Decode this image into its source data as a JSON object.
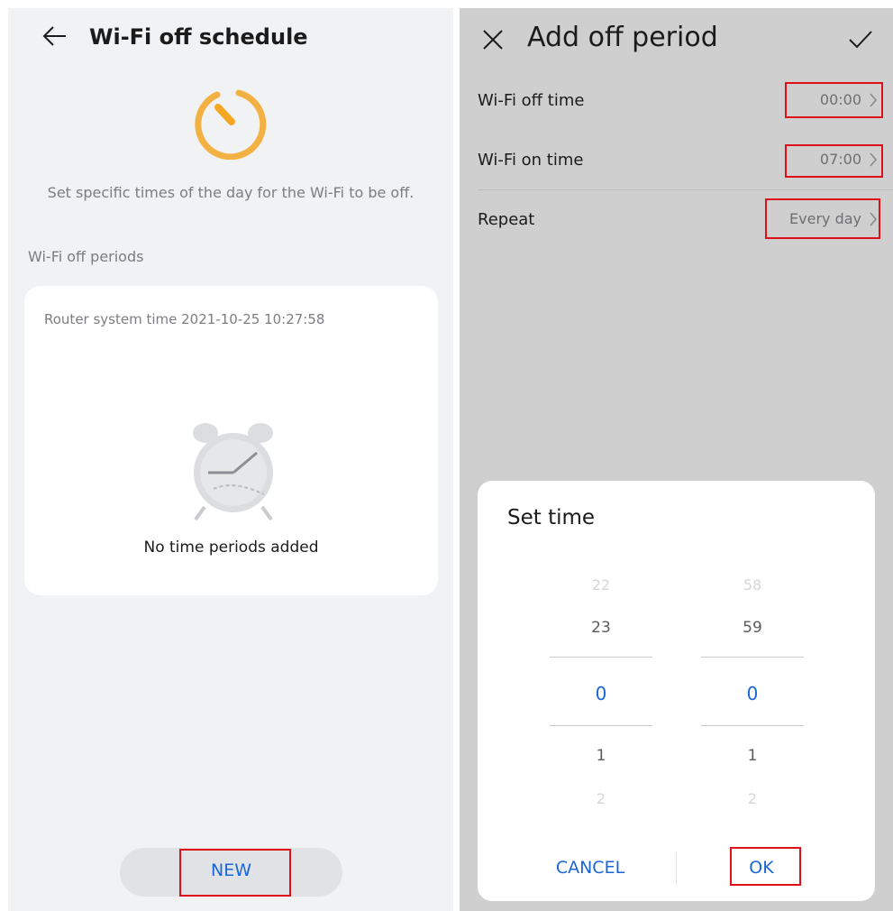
{
  "left": {
    "header": {
      "title": "Wi-Fi off schedule",
      "back_icon": "back-arrow-icon"
    },
    "hero_icon": "timer-icon",
    "description": "Set specific times of the day for the Wi-Fi to be off.",
    "section_label": "Wi-Fi off periods",
    "card": {
      "router_time": "Router system time 2021-10-25 10:27:58",
      "empty_icon": "alarm-clock-icon",
      "empty_text": "No time periods added"
    },
    "new_button": "NEW"
  },
  "right": {
    "header": {
      "title": "Add off period",
      "close_icon": "close-icon",
      "confirm_icon": "check-icon"
    },
    "rows": [
      {
        "label": "Wi-Fi off time",
        "value": "00:00"
      },
      {
        "label": "Wi-Fi on time",
        "value": "07:00"
      },
      {
        "label": "Repeat",
        "value": "Every day"
      }
    ],
    "dialog": {
      "title": "Set time",
      "hours": {
        "far_above": "22",
        "above": "23",
        "selected": "0",
        "below": "1",
        "far_below": "2"
      },
      "minutes": {
        "far_above": "58",
        "above": "59",
        "selected": "0",
        "below": "1",
        "far_below": "2"
      },
      "cancel": "CANCEL",
      "ok": "OK"
    }
  },
  "colors": {
    "accent": "#1a66d8",
    "highlight": "#e0101a",
    "timer": "#f5a623"
  }
}
